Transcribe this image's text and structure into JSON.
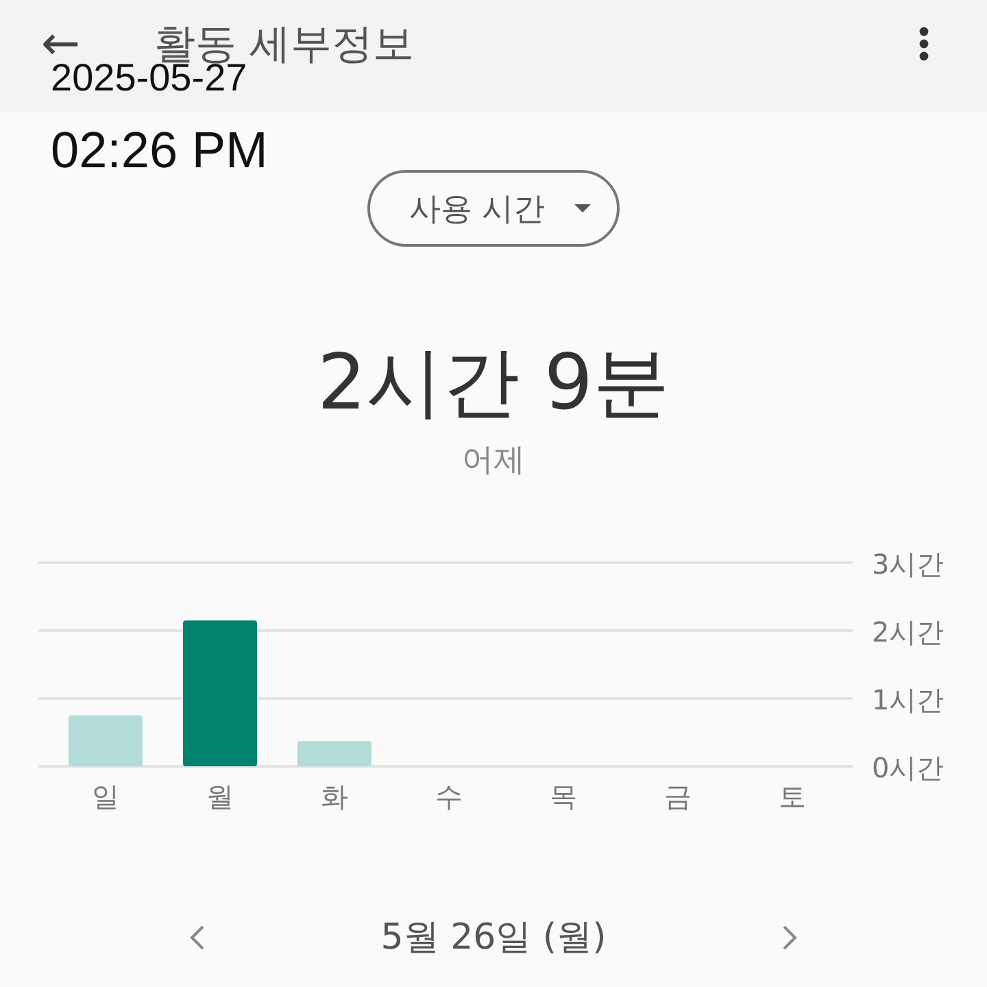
{
  "app_bar": {
    "title": "활동 세부정보",
    "back_icon": "←"
  },
  "timestamp": {
    "date": "2025-05-27",
    "time": "02:26 PM"
  },
  "metric_dropdown": {
    "label": "사용 시간"
  },
  "summary": {
    "value": "2시간 9분",
    "period": "어제"
  },
  "chart_data": {
    "type": "bar",
    "categories": [
      "일",
      "월",
      "화",
      "수",
      "목",
      "금",
      "토"
    ],
    "ylim": [
      0,
      3
    ],
    "yticks": [
      {
        "value": 0,
        "label": "0시간"
      },
      {
        "value": 1,
        "label": "1시간"
      },
      {
        "value": 2,
        "label": "2시간"
      },
      {
        "value": 3,
        "label": "3시간"
      }
    ],
    "series": [
      {
        "color": "#00826f",
        "values": [
          null,
          2.15,
          null,
          null,
          null,
          null,
          null
        ]
      },
      {
        "color": "#b2dcd7",
        "values": [
          0.75,
          null,
          0.37,
          null,
          null,
          null,
          null
        ]
      }
    ]
  },
  "date_nav": {
    "label": "5월 26일 (월)"
  }
}
